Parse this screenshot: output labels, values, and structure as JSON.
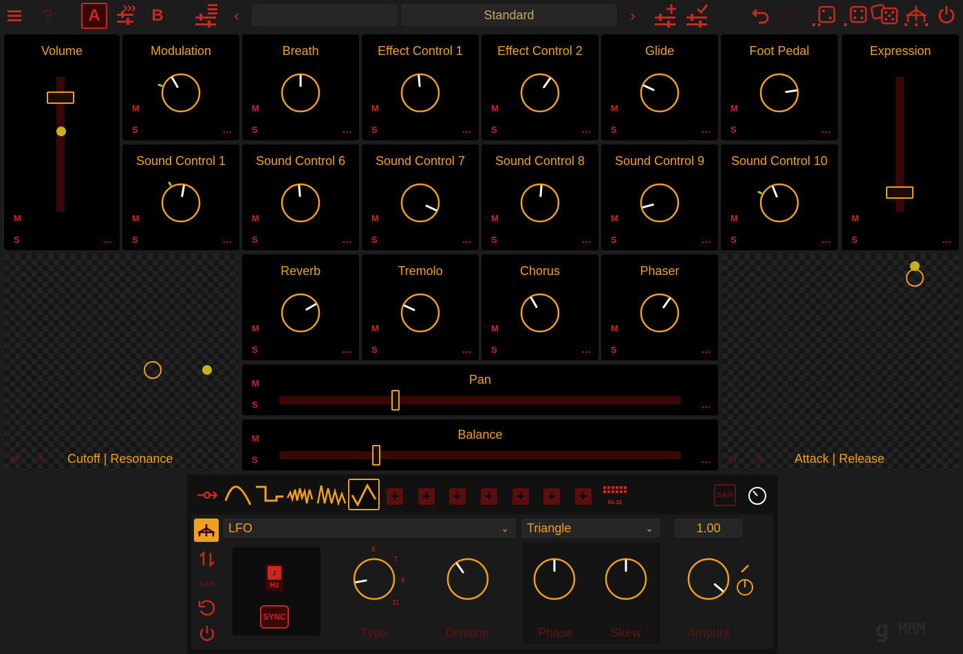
{
  "toolbar": {
    "menu_icon": "hamburger-icon",
    "help_label": "?",
    "a_label": "A",
    "b_label": "B",
    "preset_left": "",
    "preset_name": "Standard",
    "prev_label": "‹",
    "next_label": "›"
  },
  "controls": {
    "volume": {
      "label": "Volume",
      "m": "M",
      "s": "S",
      "dots": "...",
      "value": 0.82
    },
    "modulation": {
      "label": "Modulation",
      "m": "M",
      "s": "S",
      "dots": "..."
    },
    "breath": {
      "label": "Breath",
      "m": "M",
      "s": "S",
      "dots": "..."
    },
    "effect1": {
      "label": "Effect Control 1",
      "m": "M",
      "s": "S",
      "dots": "..."
    },
    "effect2": {
      "label": "Effect Control 2",
      "m": "M",
      "s": "S",
      "dots": "..."
    },
    "glide": {
      "label": "Glide",
      "m": "M",
      "s": "S",
      "dots": "..."
    },
    "foot": {
      "label": "Foot Pedal",
      "m": "M",
      "s": "S",
      "dots": "..."
    },
    "expression": {
      "label": "Expression",
      "m": "M",
      "s": "S",
      "dots": "...",
      "value": 0.15
    },
    "sc1": {
      "label": "Sound Control 1",
      "m": "M",
      "s": "S",
      "dots": "..."
    },
    "sc6": {
      "label": "Sound Control 6",
      "m": "M",
      "s": "S",
      "dots": "..."
    },
    "sc7": {
      "label": "Sound Control 7",
      "m": "M",
      "s": "S",
      "dots": "..."
    },
    "sc8": {
      "label": "Sound Control 8",
      "m": "M",
      "s": "S",
      "dots": "..."
    },
    "sc9": {
      "label": "Sound Control 9",
      "m": "M",
      "s": "S",
      "dots": "..."
    },
    "sc10": {
      "label": "Sound Control 10",
      "m": "M",
      "s": "S",
      "dots": "..."
    },
    "reverb": {
      "label": "Reverb",
      "m": "M",
      "s": "S",
      "dots": "..."
    },
    "tremolo": {
      "label": "Tremolo",
      "m": "M",
      "s": "S",
      "dots": "..."
    },
    "chorus": {
      "label": "Chorus",
      "m": "M",
      "s": "S",
      "dots": "..."
    },
    "phaser": {
      "label": "Phaser",
      "m": "M",
      "s": "S",
      "dots": "..."
    },
    "pan": {
      "label": "Pan",
      "m": "M",
      "s": "S",
      "dots": "...",
      "value": 0.29
    },
    "balance": {
      "label": "Balance",
      "m": "M",
      "s": "S",
      "dots": "...",
      "value": 0.24
    }
  },
  "xy_left": {
    "label": "Cutoff | Resonance",
    "m": "M",
    "s": "S",
    "dots": "..."
  },
  "xy_right": {
    "label": "Attack | Release",
    "m": "M",
    "s": "S",
    "dots": "..."
  },
  "lfo": {
    "source": "LFO",
    "shape": "Triangle",
    "amount_value": "1.00",
    "hz_label": "Hz",
    "sync_label": "SYNC",
    "sh_label": "S&H",
    "page_label": "01-12",
    "type_label": "Type",
    "division_label": "Division",
    "phase_label": "Phase",
    "skew_label": "Skew",
    "amount_label": "Amount",
    "type_ticks": [
      "5",
      "7",
      "9",
      "11"
    ]
  },
  "brand": {
    "logo_text": "MMM"
  },
  "colors": {
    "accent": "#f0a020",
    "red": "#c8281e",
    "track": "#3a0707"
  }
}
